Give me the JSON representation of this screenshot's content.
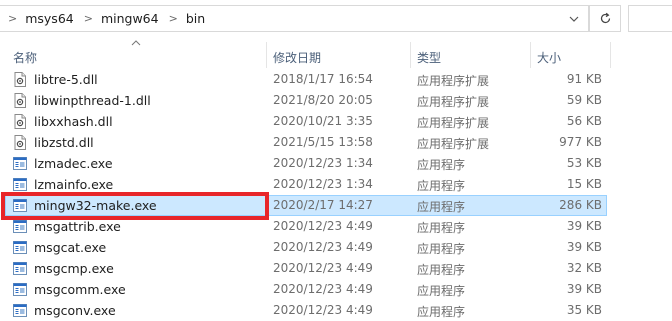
{
  "address_bar": {
    "crumbs": [
      "msys64",
      "mingw64",
      "bin"
    ],
    "separator": ">"
  },
  "columns": {
    "name": "名称",
    "date_modified": "修改日期",
    "type": "类型",
    "size": "大小"
  },
  "files": [
    {
      "name": "libtre-5.dll",
      "date": "2018/1/17 16:54",
      "type": "应用程序扩展",
      "size": "91 KB",
      "icon": "dll-file-icon"
    },
    {
      "name": "libwinpthread-1.dll",
      "date": "2021/8/20 20:05",
      "type": "应用程序扩展",
      "size": "59 KB",
      "icon": "dll-file-icon"
    },
    {
      "name": "libxxhash.dll",
      "date": "2020/10/21 3:35",
      "type": "应用程序扩展",
      "size": "56 KB",
      "icon": "dll-file-icon"
    },
    {
      "name": "libzstd.dll",
      "date": "2021/5/15 13:58",
      "type": "应用程序扩展",
      "size": "977 KB",
      "icon": "dll-file-icon"
    },
    {
      "name": "lzmadec.exe",
      "date": "2020/12/23 1:34",
      "type": "应用程序",
      "size": "53 KB",
      "icon": "exe-file-icon"
    },
    {
      "name": "lzmainfo.exe",
      "date": "2020/12/23 1:34",
      "type": "应用程序",
      "size": "15 KB",
      "icon": "exe-file-icon"
    },
    {
      "name": "mingw32-make.exe",
      "date": "2020/2/17 14:27",
      "type": "应用程序",
      "size": "286 KB",
      "icon": "exe-file-icon",
      "selected": true
    },
    {
      "name": "msgattrib.exe",
      "date": "2020/12/23 4:49",
      "type": "应用程序",
      "size": "39 KB",
      "icon": "exe-file-icon"
    },
    {
      "name": "msgcat.exe",
      "date": "2020/12/23 4:49",
      "type": "应用程序",
      "size": "39 KB",
      "icon": "exe-file-icon"
    },
    {
      "name": "msgcmp.exe",
      "date": "2020/12/23 4:49",
      "type": "应用程序",
      "size": "32 KB",
      "icon": "exe-file-icon"
    },
    {
      "name": "msgcomm.exe",
      "date": "2020/12/23 4:49",
      "type": "应用程序",
      "size": "39 KB",
      "icon": "exe-file-icon"
    },
    {
      "name": "msgconv.exe",
      "date": "2020/12/23 4:49",
      "type": "应用程序",
      "size": "35 KB",
      "icon": "exe-file-icon"
    }
  ],
  "colors": {
    "selection_bg": "#cce8ff",
    "selection_border": "#99d1ff",
    "highlight_box": "#e8262a",
    "header_text": "#4c607a"
  }
}
